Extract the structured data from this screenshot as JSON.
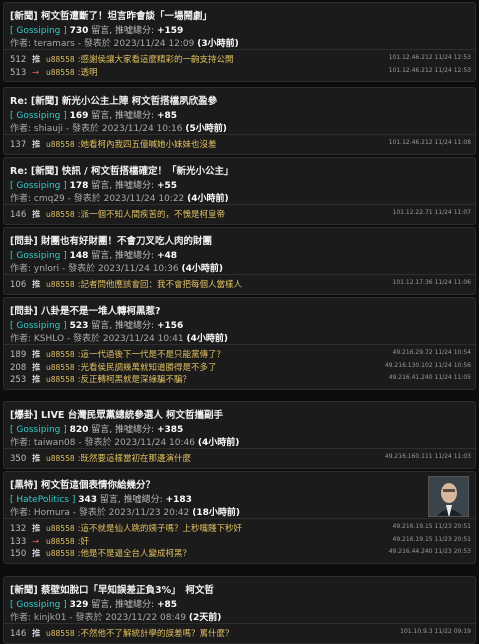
{
  "posts": [
    {
      "title": "[新聞] 柯文哲遭斷了！坦言昨會談「一場鬧劇」",
      "board": "[ Gossiping ]",
      "comments": "730",
      "comments_label": "留言,",
      "score_label": "推噓總分:",
      "score": "+159",
      "author_line": "作者: teramars - 發表於 2023/11/24 12:09",
      "ago": "(3小時前)",
      "pushes": [
        {
          "num": "512",
          "verb": "推",
          "user": "u88558",
          "text": ":感謝侯讓大家看這麼精彩的一齣支持公開",
          "ip": "101.12.46.212 11/24 12:53"
        },
        {
          "num": "513",
          "verb": "→",
          "user": "u88558",
          "text": ":透明",
          "ip": "101.12.46.212 11/24 12:53"
        }
      ]
    },
    {
      "title": "Re: [新聞] 新光小公主上陣 柯文哲搭檔夙欣盈參",
      "board": "[ Gossiping ]",
      "comments": "169",
      "comments_label": "留言,",
      "score_label": "推噓總分:",
      "score": "+85",
      "author_line": "作者: shiauji - 發表於 2023/11/24 10:16",
      "ago": "(5小時前)",
      "pushes": [
        {
          "num": "137",
          "verb": "推",
          "user": "u88558",
          "text": ":她看柯內我四五億喊她小妹妹也沒差",
          "ip": "101.12.46.212 11/24 11:08"
        }
      ]
    },
    {
      "title": "Re: [新聞] 快訊 / 柯文哲搭檔確定！「新光小公主」",
      "board": "[ Gossiping ]",
      "comments": "178",
      "comments_label": "留言,",
      "score_label": "推噓總分:",
      "score": "+55",
      "author_line": "作者: cmq29 - 發表於 2023/11/24 10:22",
      "ago": "(4小時前)",
      "pushes": [
        {
          "num": "146",
          "verb": "推",
          "user": "u88558",
          "text": ":派一個不知人間疾苦的，不愧是柯皇帝",
          "ip": "101.12.22.71 11/24 11:07"
        }
      ]
    },
    {
      "title": "[問卦] 財團也有好財團！不會刀叉吃人肉的財團",
      "board": "[ Gossiping ]",
      "comments": "148",
      "comments_label": "留言,",
      "score_label": "推噓總分:",
      "score": "+48",
      "author_line": "作者: ynlori - 發表於 2023/11/24 10:36",
      "ago": "(4小時前)",
      "pushes": [
        {
          "num": "106",
          "verb": "推",
          "user": "u88558",
          "text": ":記者問他應該會回：我不會把每個人當樣人",
          "ip": "101.12.17.36 11/24 11:06"
        }
      ]
    },
    {
      "title": "[問卦] 八卦是不是一堆人轉柯黑惹?",
      "board": "[ Gossiping ]",
      "comments": "523",
      "comments_label": "留言,",
      "score_label": "推噓總分:",
      "score": "+156",
      "author_line": "作者: KSHLO - 發表於 2023/11/24 10:41",
      "ago": "(4小時前)",
      "pushes": [
        {
          "num": "189",
          "verb": "推",
          "user": "u88558",
          "text": ":這一代過後下一代是不是只能黨傳了？",
          "ip": "49.216.29.72 11/24 10:54"
        },
        {
          "num": "208",
          "verb": "推",
          "user": "u88558",
          "text": ":光看侯民調幾萬就知道勝得是不多了",
          "ip": "49.216.130.102 11/24 10:56"
        },
        {
          "num": "253",
          "verb": "推",
          "user": "u88558",
          "text": ":反正轉柯黑就是深綠騙不騙？",
          "ip": "49.216.41.240 11/24 11:05"
        }
      ]
    },
    {
      "title": "[爆卦] LIVE 台灣民眾黨總統參選人 柯文哲攜副手",
      "board": "[ Gossiping ]",
      "comments": "820",
      "comments_label": "留言,",
      "score_label": "推噓總分:",
      "score": "+385",
      "author_line": "作者: taiwan08 - 發表於 2023/11/24 10:46",
      "ago": "(4小時前)",
      "pushes": [
        {
          "num": "350",
          "verb": "推",
          "user": "u88558",
          "text": ":既然要這樣當初在那邊演什麼",
          "ip": "49.216.160.111 11/24 11:03"
        }
      ]
    },
    {
      "title": "[黑特] 柯文哲這個表情你給幾分？",
      "board": "[ HatePolitics ]",
      "comments": "343",
      "comments_label": "留言,",
      "score_label": "推噓總分:",
      "score": "+183",
      "author_line": "作者: Homura - 發表於 2023/11/23 20:42",
      "ago": "(18小時前)",
      "has_thumb": true,
      "pushes": [
        {
          "num": "132",
          "verb": "推",
          "user": "u88558",
          "text": ":這不就是仙人跳的姨子嗎？上秒嘴賤下秒奸",
          "ip": "49.216.19.15 11/23 20:51"
        },
        {
          "num": "133",
          "verb": "→",
          "user": "u88558",
          "text": ":奸",
          "ip": "49.216.19.15 11/23 20:51"
        },
        {
          "num": "150",
          "verb": "推",
          "user": "u88558",
          "text": ":他是不是逼全台人變成柯黑？",
          "ip": "49.216.44.240 11/23 20:53"
        }
      ]
    },
    {
      "title": "[新聞] 蔡壁如脫口「早知誤差正負3%」　柯文哲",
      "board": "[ Gossiping ]",
      "comments": "329",
      "comments_label": "留言,",
      "score_label": "推噓總分:",
      "score": "+85",
      "author_line": "作者: kinjk01 - 發表於 2023/11/22 08:49",
      "ago": "(2天前)",
      "pushes": [
        {
          "num": "146",
          "verb": "推",
          "user": "u88558",
          "text": ":不然他不了解統計學的誤差嗎？罵什麼？",
          "ip": "101.10.9.3 11/22 09:19"
        }
      ]
    }
  ],
  "colors": {
    "board": "#33cccc",
    "push_text": "#e0c060",
    "arrow": "#ff5555",
    "card_bg": "#1b1b1b"
  }
}
